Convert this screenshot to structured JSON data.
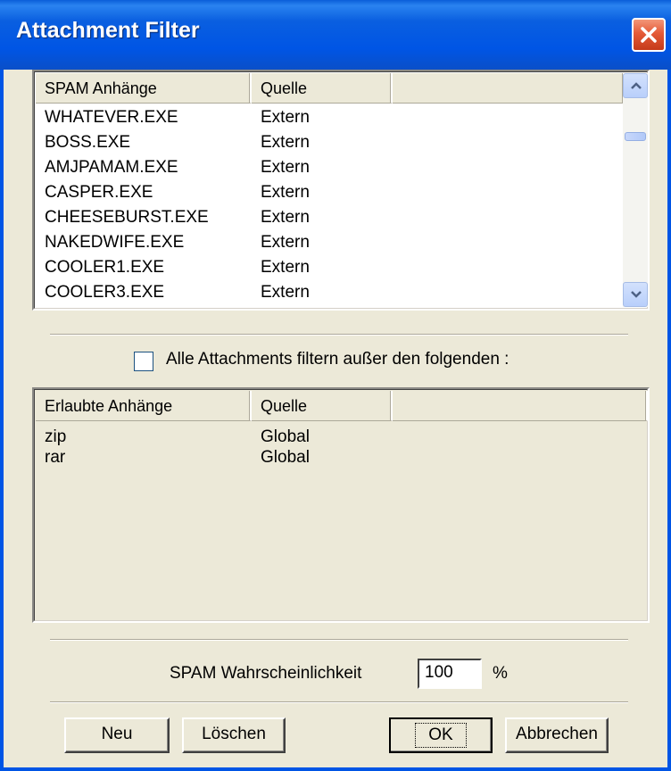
{
  "window": {
    "title": "Attachment Filter"
  },
  "spam_list": {
    "columns": [
      "SPAM Anhänge",
      "Quelle",
      ""
    ],
    "rows": [
      [
        "WHATEVER.EXE",
        "Extern"
      ],
      [
        "BOSS.EXE",
        "Extern"
      ],
      [
        "AMJPAMAM.EXE",
        "Extern"
      ],
      [
        "CASPER.EXE",
        "Extern"
      ],
      [
        "CHEESEBURST.EXE",
        "Extern"
      ],
      [
        "NAKEDWIFE.EXE",
        "Extern"
      ],
      [
        "COOLER1.EXE",
        "Extern"
      ],
      [
        "COOLER3.EXE",
        "Extern"
      ]
    ]
  },
  "filter_all": {
    "label": "Alle Attachments filtern außer den folgenden :",
    "checked": false
  },
  "allowed_list": {
    "columns": [
      "Erlaubte Anhänge",
      "Quelle",
      ""
    ],
    "rows": [
      [
        "zip",
        "Global"
      ],
      [
        "rar",
        "Global"
      ]
    ]
  },
  "probability": {
    "label": "SPAM Wahrscheinlichkeit",
    "value": "100",
    "unit": "%"
  },
  "buttons": {
    "new": "Neu",
    "delete": "Löschen",
    "ok": "OK",
    "cancel": "Abbrechen"
  },
  "colors": {
    "titlebar": "#0055e5",
    "dialog_bg": "#ece9d8",
    "close": "#e45a37"
  },
  "icons": {
    "close": "close-icon",
    "scroll_up": "chevron-up-icon",
    "scroll_down": "chevron-down-icon"
  }
}
